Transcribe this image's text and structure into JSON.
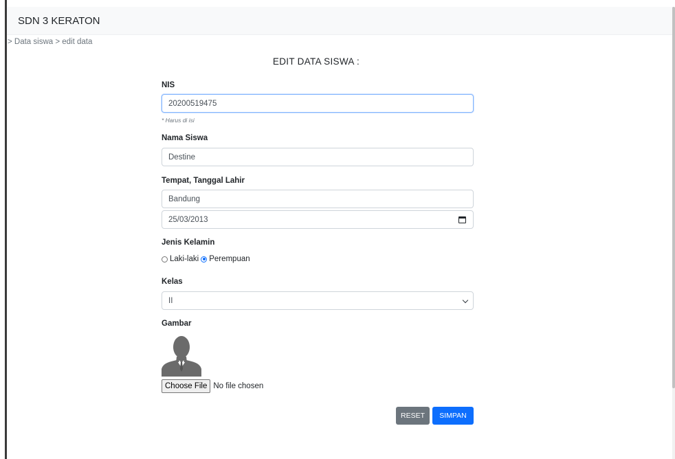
{
  "navbar": {
    "brand": "SDN 3 KERATON"
  },
  "breadcrumb": "> Data siswa > edit data",
  "form": {
    "title": "EDIT DATA SISWA :",
    "nis": {
      "label": "NIS",
      "value": "20200519475",
      "hint": "* Harus di isi"
    },
    "nama": {
      "label": "Nama Siswa",
      "value": "Destine"
    },
    "ttl": {
      "label": "Tempat, Tanggal Lahir",
      "tempat": "Bandung",
      "tanggal": "25/03/2013"
    },
    "jenis_kelamin": {
      "label": "Jenis Kelamin",
      "options": [
        "Laki-laki",
        "Perempuan"
      ],
      "selected": "Perempuan"
    },
    "kelas": {
      "label": "Kelas",
      "value": "II"
    },
    "gambar": {
      "label": "Gambar",
      "file_button": "Choose File",
      "file_status": "No file chosen"
    },
    "buttons": {
      "reset": "RESET",
      "save": "SIMPAN"
    }
  },
  "icons": {
    "calendar": "calendar-icon",
    "dropdown": "chevron-down-icon",
    "avatar": "user-silhouette"
  },
  "colors": {
    "primary": "#0d6efd",
    "secondary": "#6c757d",
    "navbar_bg": "#f8f9fa"
  }
}
